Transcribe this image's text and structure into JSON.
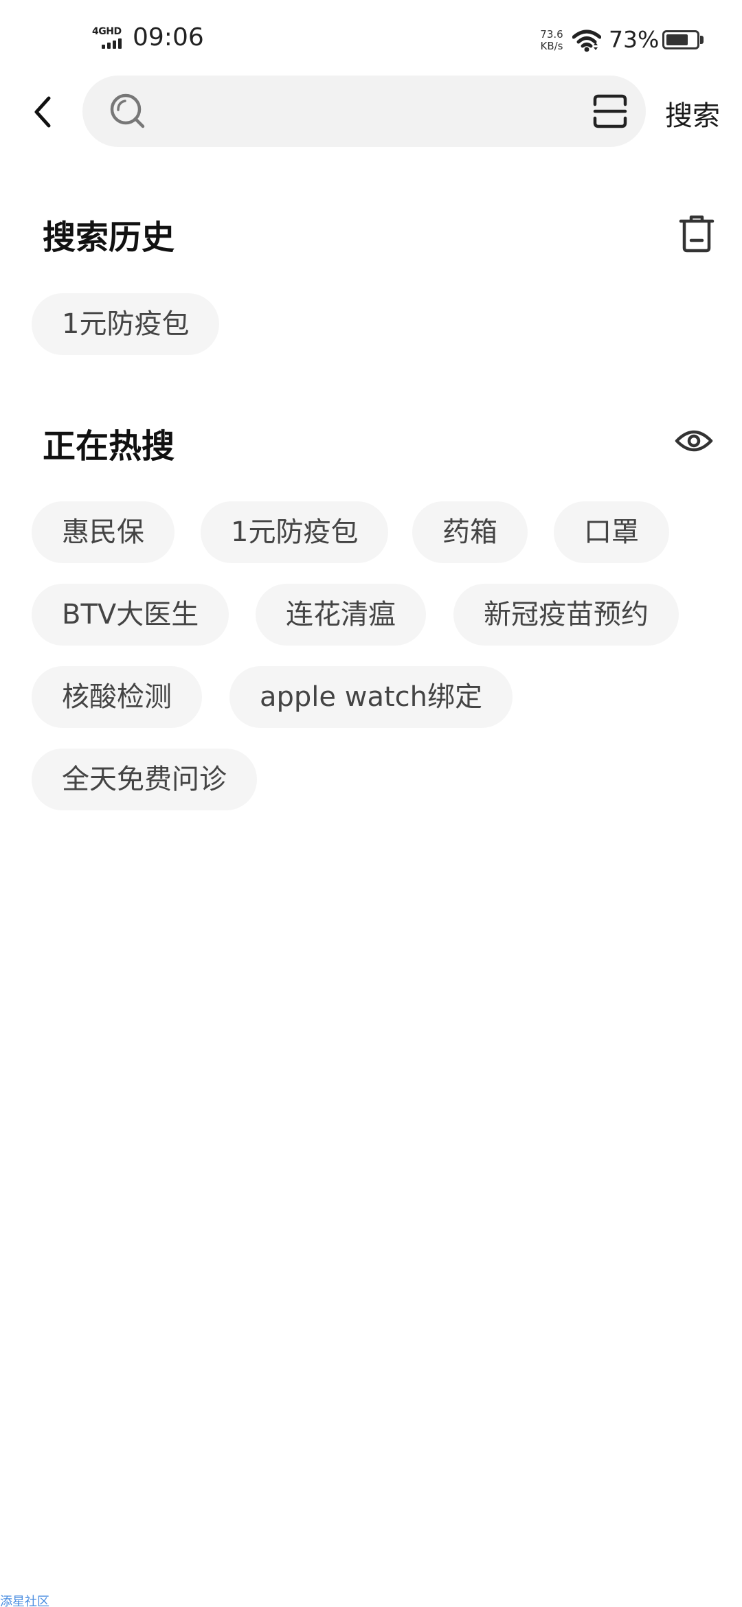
{
  "status_bar": {
    "network": "4GHD",
    "time": "09:06",
    "speed_value": "73.6",
    "speed_unit": "KB/s",
    "battery_percent_text": "73%",
    "battery_level": 0.73
  },
  "header": {
    "search_placeholder": "",
    "search_value": "",
    "search_button_label": "搜索"
  },
  "history": {
    "title": "搜索历史",
    "items": [
      "1元防疫包"
    ]
  },
  "hot": {
    "title": "正在热搜",
    "items": [
      "惠民保",
      "1元防疫包",
      "药箱",
      "口罩",
      "BTV大医生",
      "连花清瘟",
      "新冠疫苗预约",
      "核酸检测",
      "apple watch绑定",
      "全天免费问诊"
    ]
  },
  "watermark": "添星社区",
  "colors": {
    "chip_background": "#f5f5f5",
    "search_background": "#f2f2f2",
    "text_primary": "#111111",
    "text_chip": "#444444"
  },
  "icons": {
    "back": "chevron-left-icon",
    "search": "search-icon",
    "scan": "scan-icon",
    "delete": "trash-icon",
    "visibility": "eye-icon",
    "wifi": "wifi-icon",
    "battery": "battery-icon"
  }
}
